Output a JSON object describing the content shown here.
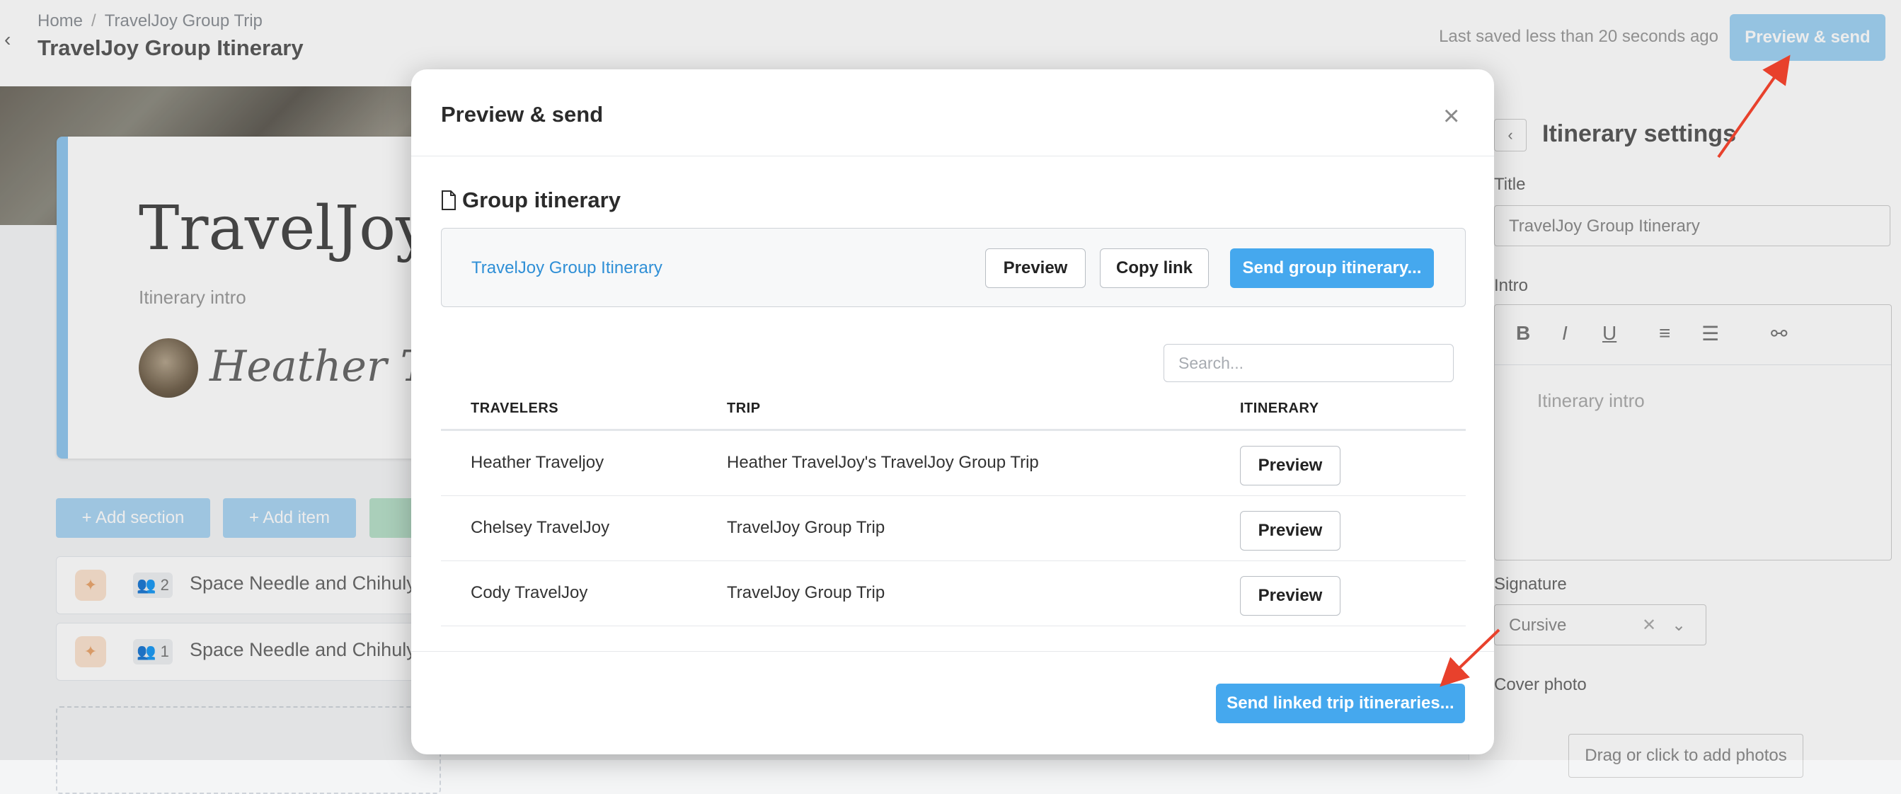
{
  "header": {
    "breadcrumb": [
      "Home",
      "TravelJoy Group Trip"
    ],
    "breadcrumb_sep": "/",
    "title": "TravelJoy Group Itinerary",
    "saved_text": "Last saved less than 20 seconds ago",
    "preview_send_label": "Preview & send"
  },
  "editor": {
    "card_title": "TravelJoy G",
    "intro_placeholder": "Itinerary intro",
    "signature_text": "Heather Trav",
    "add_section_label": "+ Add section",
    "add_item_label": "+ Add item",
    "items": [
      {
        "count": "2",
        "text": "Space Needle and Chihuly"
      },
      {
        "count": "1",
        "text": "Space Needle and Chihuly"
      }
    ]
  },
  "settings": {
    "title": "Itinerary settings",
    "title_label": "Title",
    "title_value": "TravelJoy Group Itinerary",
    "intro_label": "Intro",
    "intro_placeholder": "Itinerary intro",
    "signature_label": "Signature",
    "signature_value": "Cursive",
    "cover_label": "Cover photo",
    "cover_drop": "Drag or click to add photos"
  },
  "modal": {
    "title": "Preview & send",
    "close_glyph": "×",
    "section_title": "Group itinerary",
    "group_link": "TravelJoy Group Itinerary",
    "preview_label": "Preview",
    "copy_link_label": "Copy link",
    "send_group_label": "Send group itinerary...",
    "search_placeholder": "Search...",
    "columns": [
      "TRAVELERS",
      "TRIP",
      "ITINERARY"
    ],
    "rows": [
      {
        "traveler": "Heather Traveljoy",
        "trip": "Heather TravelJoy's TravelJoy Group Trip",
        "action": "Preview"
      },
      {
        "traveler": "Chelsey TravelJoy",
        "trip": "TravelJoy Group Trip",
        "action": "Preview"
      },
      {
        "traveler": "Cody TravelJoy",
        "trip": "TravelJoy Group Trip",
        "action": "Preview"
      }
    ],
    "send_linked_label": "Send linked trip itineraries..."
  },
  "colors": {
    "primary": "#45a8ee",
    "link": "#2f8fd6",
    "annotation_arrow": "#e8412c"
  },
  "icons": {
    "document": "document-icon",
    "close": "close-icon"
  }
}
